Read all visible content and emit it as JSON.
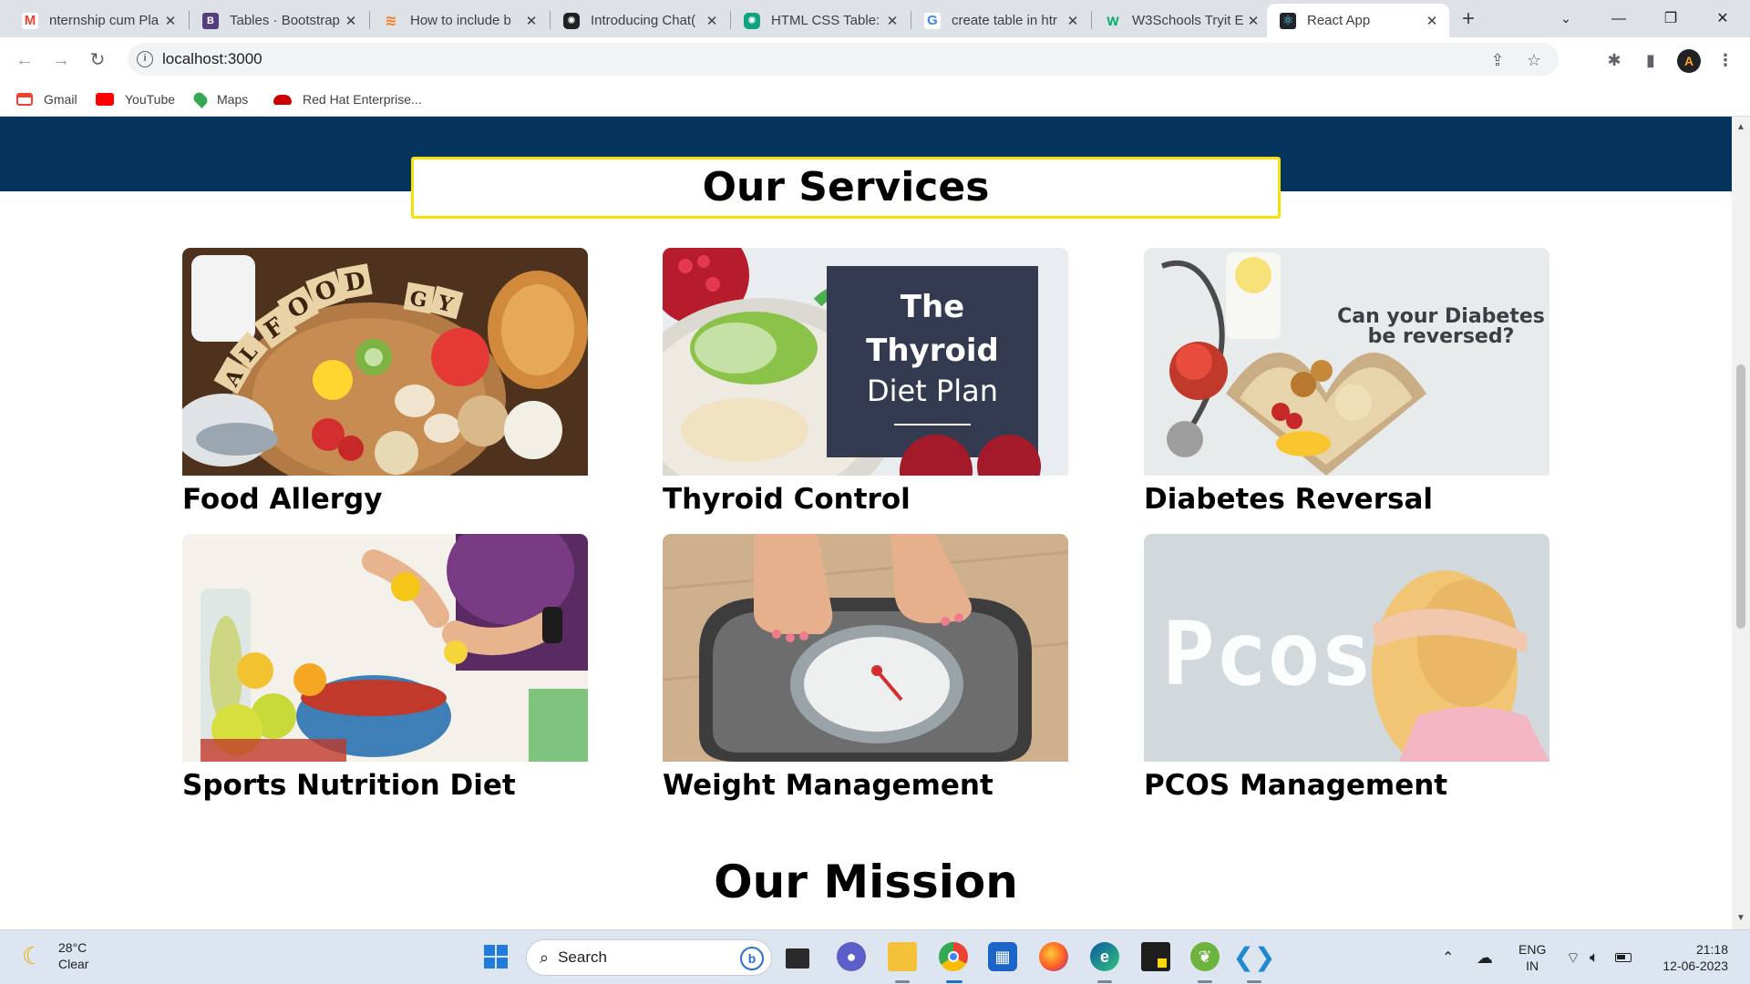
{
  "browser": {
    "tabs": [
      {
        "title": "nternship cum Pla",
        "favicon": "gmail-icon",
        "color": "#ea4335"
      },
      {
        "title": "Tables · Bootstrap",
        "favicon": "bootstrap-icon",
        "color": "#563d7c"
      },
      {
        "title": "How to include b",
        "favicon": "stackoverflow-icon",
        "color": "#f48024"
      },
      {
        "title": "Introducing Chat(",
        "favicon": "openai-icon",
        "color": "#202123"
      },
      {
        "title": "HTML CSS Table:",
        "favicon": "openai-icon",
        "color": "#10a37f"
      },
      {
        "title": "create table in htr",
        "favicon": "google-icon",
        "color": "#4285f4"
      },
      {
        "title": "W3Schools Tryit E",
        "favicon": "w3schools-icon",
        "color": "#04aa6d"
      },
      {
        "title": "React App",
        "favicon": "react-icon",
        "color": "#20232a"
      }
    ],
    "url": "localhost:3000",
    "bookmarks": [
      {
        "label": "Gmail",
        "color": "#ea4335"
      },
      {
        "label": "YouTube",
        "color": "#ff0000"
      },
      {
        "label": "Maps",
        "color": "#34a853"
      },
      {
        "label": "Red Hat Enterprise...",
        "color": "#cc0000"
      }
    ]
  },
  "page": {
    "services_heading": "Our Services",
    "services": [
      {
        "title": "Food Allergy",
        "image_text": [
          "FOOD",
          "ALLERGY"
        ]
      },
      {
        "title": "Thyroid Control",
        "image_text": [
          "The",
          "Thyroid",
          "Diet Plan"
        ]
      },
      {
        "title": "Diabetes Reversal",
        "image_text": [
          "Can your Diabetes",
          "be reversed?"
        ]
      },
      {
        "title": "Sports Nutrition Diet",
        "image_text": []
      },
      {
        "title": "Weight Management",
        "image_text": []
      },
      {
        "title": "PCOS Management",
        "image_text": [
          "Pcos"
        ]
      }
    ],
    "mission_heading": "Our Mission",
    "colors": {
      "hero_band": "#04345d",
      "title_border": "#f5e10a"
    }
  },
  "taskbar": {
    "weather_temp": "28°C",
    "weather_desc": "Clear",
    "search_placeholder": "Search",
    "lang_line1": "ENG",
    "lang_line2": "IN",
    "time": "21:18",
    "date": "12-06-2023"
  }
}
